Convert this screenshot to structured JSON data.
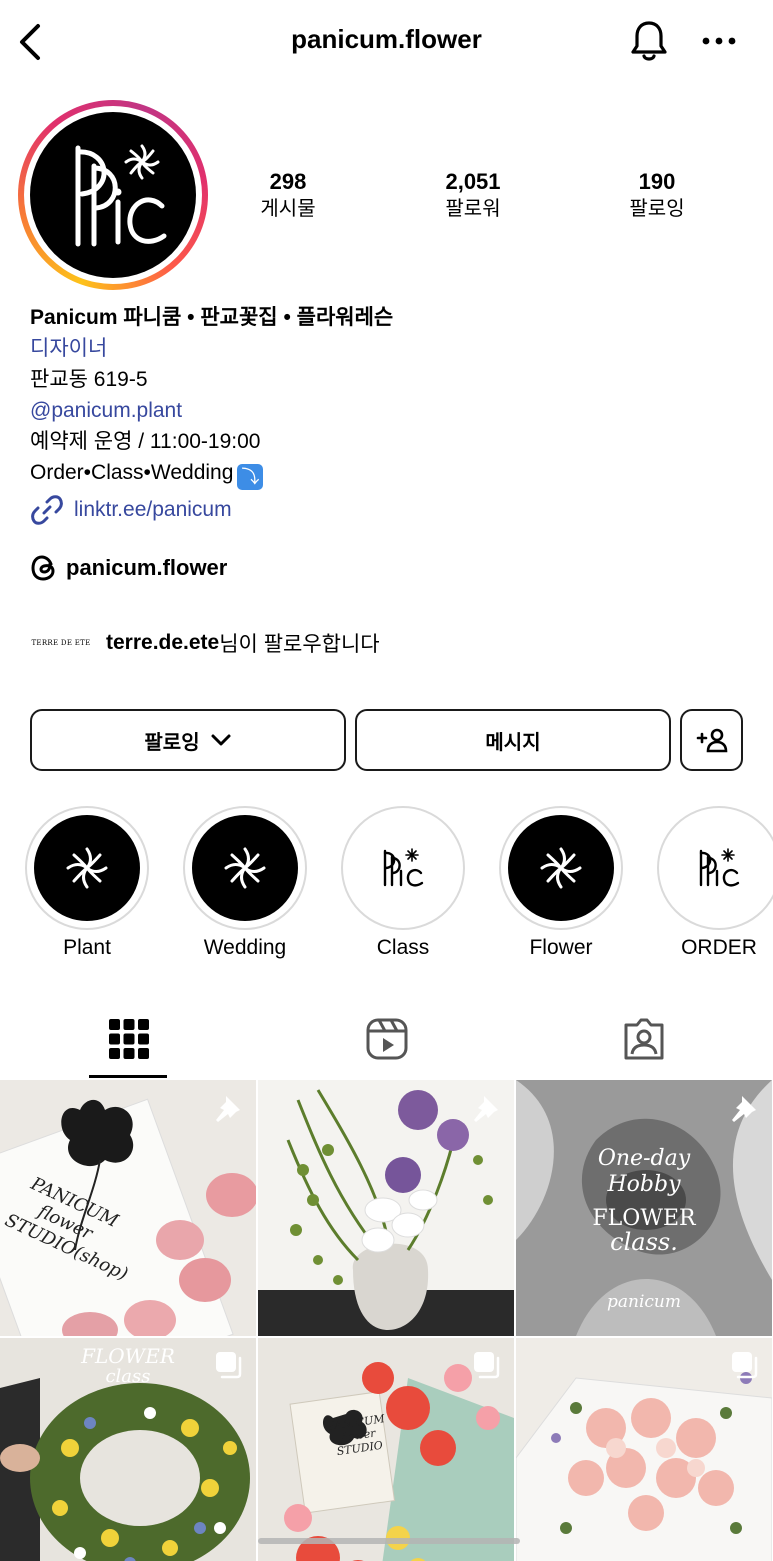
{
  "header": {
    "username": "panicum.flower",
    "back_icon": "chevron-left-icon",
    "bell_icon": "bell-icon",
    "more_icon": "more-horizontal-icon"
  },
  "profile": {
    "avatar_text": "PPiC",
    "stats": [
      {
        "value": "298",
        "label": "게시물"
      },
      {
        "value": "2,051",
        "label": "팔로워"
      },
      {
        "value": "190",
        "label": "팔로잉"
      }
    ]
  },
  "bio": {
    "name": "Panicum 파니쿰 • 판교꽃집 • 플라워레슨",
    "category": "디자이너",
    "address": "판교동 619-5",
    "mention": "@panicum.plant",
    "hours": "예약제 운영 / 11:00-19:00",
    "services": "Order•Class•Wedding",
    "services_emoji": "⤵",
    "link": "linktr.ee/panicum",
    "threads_handle": "panicum.flower"
  },
  "followed_by": {
    "logo_text": "TERRE DE ETE",
    "name": "terre.de.ete",
    "suffix": "님이 팔로우합니다"
  },
  "actions": {
    "following_label": "팔로잉",
    "message_label": "메시지"
  },
  "highlights": [
    {
      "label": "Plant",
      "style": "dark"
    },
    {
      "label": "Wedding",
      "style": "dark"
    },
    {
      "label": "Class",
      "style": "light"
    },
    {
      "label": "Flower",
      "style": "dark"
    },
    {
      "label": "ORDER",
      "style": "light"
    }
  ],
  "tabs": [
    "grid-icon",
    "reels-icon",
    "tagged-icon"
  ],
  "posts": {
    "tile1": {
      "text": "PANICUM flower STUDIO(shop)"
    },
    "tile3": {
      "line1": "One-day",
      "line2": "Hobby",
      "line3": "FLOWER",
      "line4": "class.",
      "line5": "panicum"
    },
    "tile4": {
      "line1": "FLOWER",
      "line2": "class"
    },
    "tile5": {
      "text": "PANICUM flower STUDIO"
    }
  },
  "colors": {
    "link_blue": "#37489e",
    "ring_gradient": [
      "#fdc21a",
      "#f77737",
      "#e1306c",
      "#c13584"
    ]
  }
}
